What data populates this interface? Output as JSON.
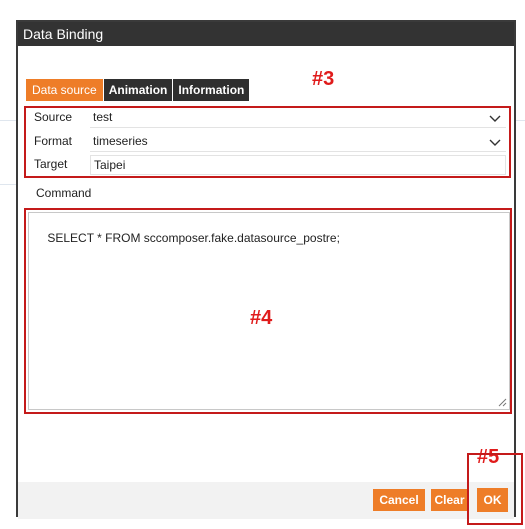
{
  "dialog": {
    "title": "Data Binding"
  },
  "tabs": [
    {
      "label": "Data source",
      "active": true
    },
    {
      "label": "Animation",
      "active": false
    },
    {
      "label": "Information",
      "active": false
    }
  ],
  "form": {
    "source_label": "Source",
    "source_value": "test",
    "format_label": "Format",
    "format_value": "timeseries",
    "target_label": "Target",
    "target_value": "Taipei"
  },
  "command": {
    "label": "Command",
    "value": "SELECT * FROM sccomposer.fake.datasource_postre;"
  },
  "buttons": {
    "cancel": "Cancel",
    "clear": "Clear",
    "ok": "OK"
  },
  "annotations": {
    "a3": "#3",
    "a4": "#4",
    "a5": "#5"
  },
  "colors": {
    "accent": "#ee7d28",
    "titlebar": "#333333",
    "annotation": "#e01b1b"
  }
}
